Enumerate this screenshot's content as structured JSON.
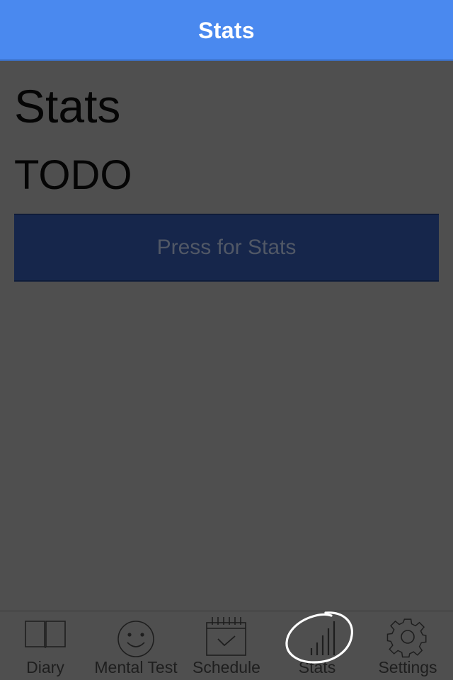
{
  "nav": {
    "title": "Stats"
  },
  "content": {
    "title": "Stats",
    "subtitle": "TODO",
    "button_label": "Press for Stats"
  },
  "tabs": [
    {
      "label": "Diary",
      "icon": "book-icon"
    },
    {
      "label": "Mental Test",
      "icon": "smiley-face-icon"
    },
    {
      "label": "Schedule",
      "icon": "calendar-check-icon"
    },
    {
      "label": "Stats",
      "icon": "bar-chart-icon"
    },
    {
      "label": "Settings",
      "icon": "gear-icon"
    }
  ],
  "colors": {
    "nav_background": "#4a89ef",
    "page_background": "#4f4f4f",
    "button_background": "#16264b",
    "button_text": "#515866"
  }
}
